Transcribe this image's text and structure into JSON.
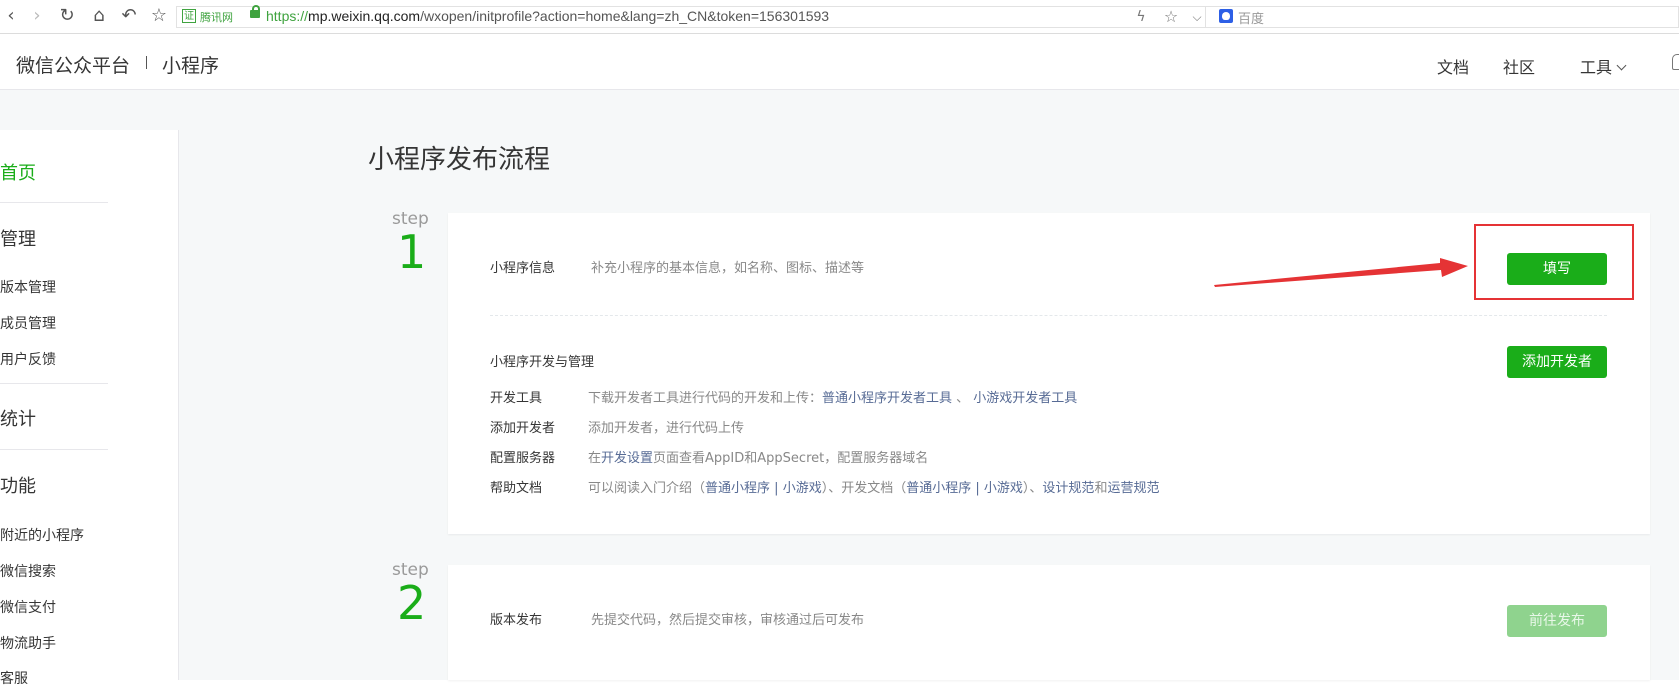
{
  "browser": {
    "cert_label": "腾讯网",
    "url_scheme": "https://",
    "url_host": "mp.weixin.qq.com",
    "url_path": "/wxopen/initprofile?action=home&lang=zh_CN&token=156301593",
    "search_placeholder": "百度",
    "cert_glyph": "证",
    "icons": [
      "back-icon",
      "forward-icon",
      "reload-icon",
      "home-icon",
      "undo-icon",
      "star-icon",
      "lightning-icon",
      "bookmark-star-icon",
      "chevron-down-icon",
      "baidu-icon"
    ]
  },
  "header": {
    "logo": "微信公众平台",
    "product": "小程序",
    "links": {
      "docs": "文档",
      "community": "社区",
      "tools": "工具"
    }
  },
  "sidebar": {
    "home": "首页",
    "manage": "管理",
    "manage_items": [
      "版本管理",
      "成员管理",
      "用户反馈"
    ],
    "stats": "统计",
    "features": "功能",
    "feature_items": [
      "附近的小程序",
      "微信搜索",
      "微信支付",
      "物流助手",
      "客服"
    ]
  },
  "main": {
    "title": "小程序发布流程",
    "step_word": "step",
    "step1": {
      "num": "1",
      "info_label": "小程序信息",
      "info_desc": "补充小程序的基本信息，如名称、图标、描述等",
      "fill_button": "填写",
      "dev_title": "小程序开发与管理",
      "add_dev_button": "添加开发者",
      "rows": {
        "tools": {
          "label": "开发工具",
          "text": "下载开发者工具进行代码的开发和上传：",
          "link1": "普通小程序开发者工具",
          "sep": " 、 ",
          "link2": "小游戏开发者工具"
        },
        "add_dev": {
          "label": "添加开发者",
          "text": "添加开发者，进行代码上传"
        },
        "server": {
          "label": "配置服务器",
          "pre": "在",
          "link": "开发设置",
          "post": "页面查看AppID和AppSecret，配置服务器域名"
        },
        "help": {
          "label": "帮助文档",
          "t1": "可以阅读入门介绍（",
          "l1": "普通小程序",
          "bar1": " | ",
          "l2": "小游戏",
          "t2": "）、开发文档（",
          "l3": "普通小程序",
          "bar2": " | ",
          "l4": "小游戏",
          "t3": "）、",
          "l5": "设计规范",
          "t4": "和",
          "l6": "运营规范"
        }
      }
    },
    "step2": {
      "num": "2",
      "label": "版本发布",
      "desc": "先提交代码，然后提交审核，审核通过后可发布",
      "button": "前往发布"
    }
  },
  "colors": {
    "accent": "#1aad19",
    "link": "#576b95",
    "annotation": "#e53335"
  }
}
